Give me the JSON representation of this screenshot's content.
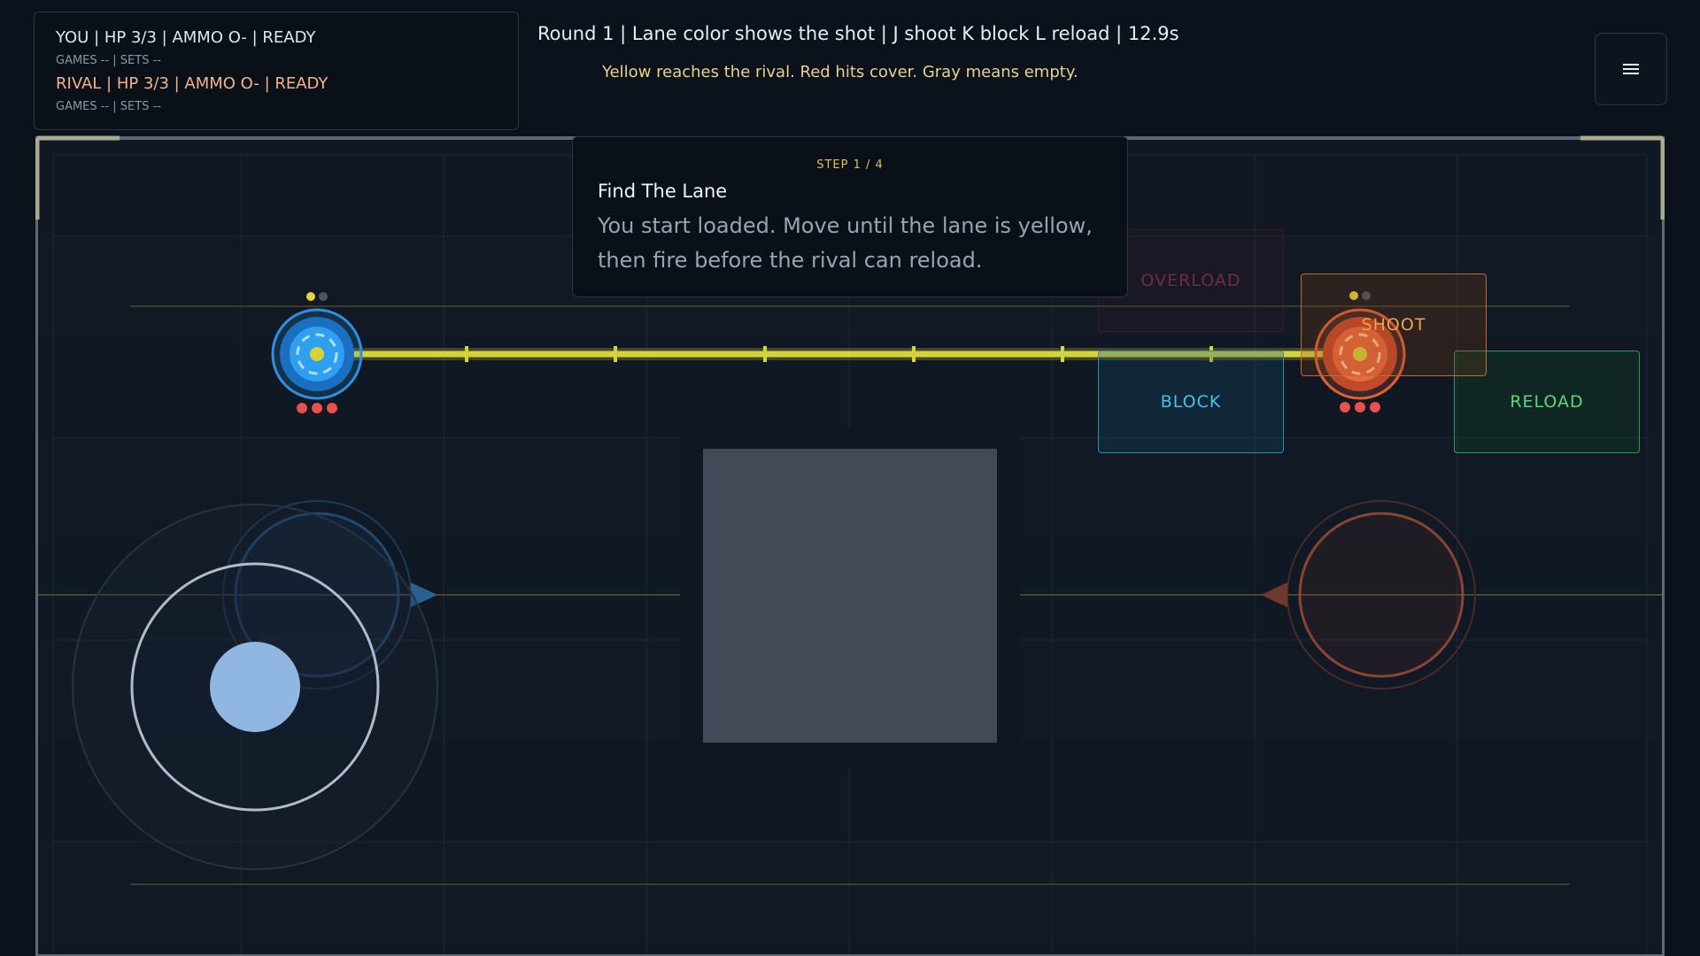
{
  "hud": {
    "player_status": "YOU | HP 3/3 | AMMO O- | READY",
    "player_record": "GAMES -- | SETS --",
    "rival_status": "RIVAL | HP 3/3 | AMMO O- | READY",
    "rival_record": "GAMES -- | SETS --",
    "round_info": "Round 1 | Lane color shows the shot | J shoot K block L reload | 12.9s",
    "hint": "Yellow reaches the rival. Red hits cover. Gray means empty.",
    "menu_icon": "hamburger-menu-icon"
  },
  "tutorial": {
    "step": "STEP 1 / 4",
    "title": "Find The Lane",
    "body": "You start loaded. Move until the lane is yellow, then fire before the rival can reload."
  },
  "actions": {
    "overload": "OVERLOAD",
    "shoot": "SHOOT",
    "block": "BLOCK",
    "reload": "RELOAD"
  },
  "game": {
    "player_hp": 3,
    "rival_hp": 3,
    "lane_state": "yellow",
    "colors": {
      "player": "#2f8fe0",
      "rival": "#e0603a",
      "lane": "#d6d23a",
      "hp_pip": "#e8524a",
      "ammo_loaded": "#e6d23a",
      "ammo_empty": "#4a5563"
    }
  }
}
